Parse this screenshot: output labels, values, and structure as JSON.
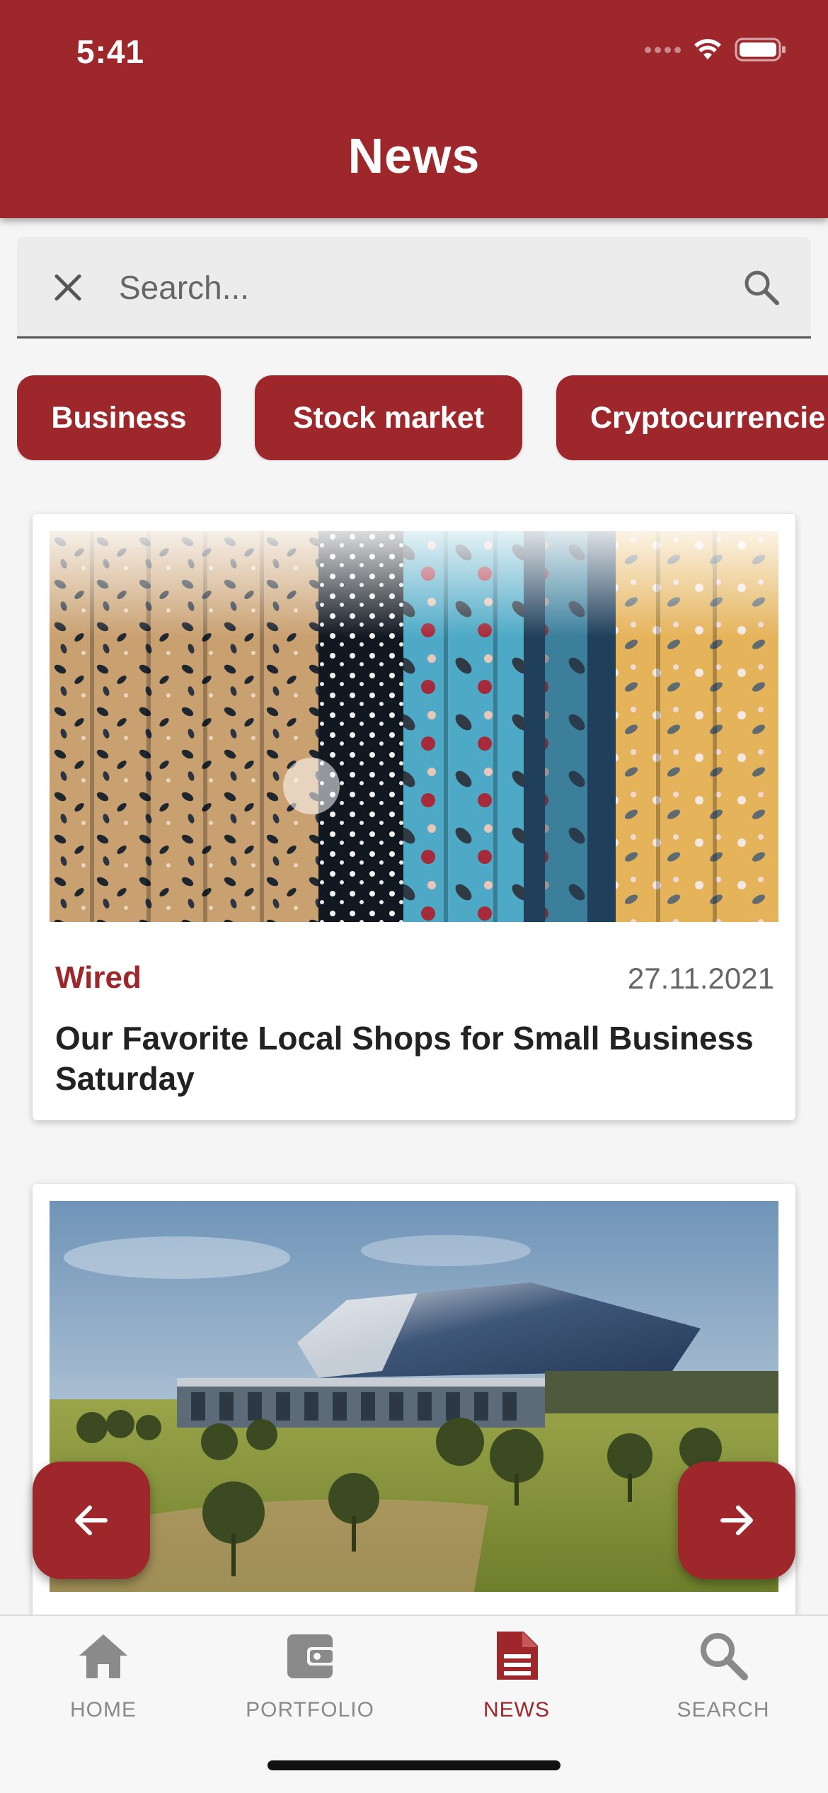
{
  "status_bar": {
    "time": "5:41"
  },
  "header": {
    "title": "News"
  },
  "search": {
    "placeholder": "Search...",
    "value": ""
  },
  "categories": [
    {
      "label": "Business"
    },
    {
      "label": "Stock market"
    },
    {
      "label": "Cryptocurrencie"
    }
  ],
  "articles": [
    {
      "source": "Wired",
      "date": "27.11.2021",
      "title": "Our Favorite Local Shops for Small Business Saturday",
      "image": "clothing-rack-photo"
    },
    {
      "image": "stadium-rendering-photo"
    }
  ],
  "navigation": {
    "prev_icon": "arrow-left-icon",
    "next_icon": "arrow-right-icon"
  },
  "tabbar": {
    "items": [
      {
        "label": "HOME",
        "icon": "home-icon",
        "active": false
      },
      {
        "label": "PORTFOLIO",
        "icon": "wallet-icon",
        "active": false
      },
      {
        "label": "NEWS",
        "icon": "news-icon",
        "active": true
      },
      {
        "label": "SEARCH",
        "icon": "search-icon",
        "active": false
      }
    ]
  },
  "colors": {
    "primary": "#9e272b",
    "inactive": "#8a8a8a",
    "background": "#f5f5f5"
  }
}
